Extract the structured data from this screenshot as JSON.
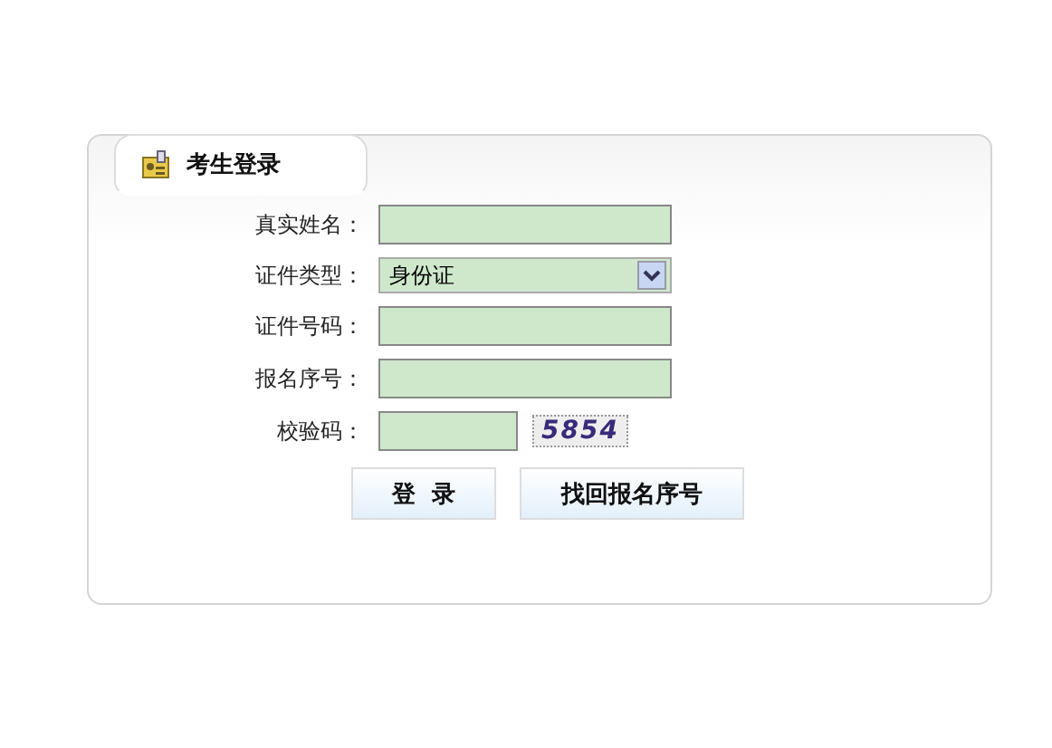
{
  "panel": {
    "title": "考生登录"
  },
  "fields": [
    {
      "kind": "input",
      "label": "真实姓名："
    },
    {
      "kind": "select",
      "label": "证件类型：",
      "value": "身份证"
    },
    {
      "kind": "input",
      "label": "证件号码："
    },
    {
      "kind": "input",
      "label": "报名序号："
    },
    {
      "kind": "captcha",
      "label": "校验码：",
      "code": "5854"
    }
  ],
  "buttons": [
    "登  录",
    "找回报名序号"
  ]
}
